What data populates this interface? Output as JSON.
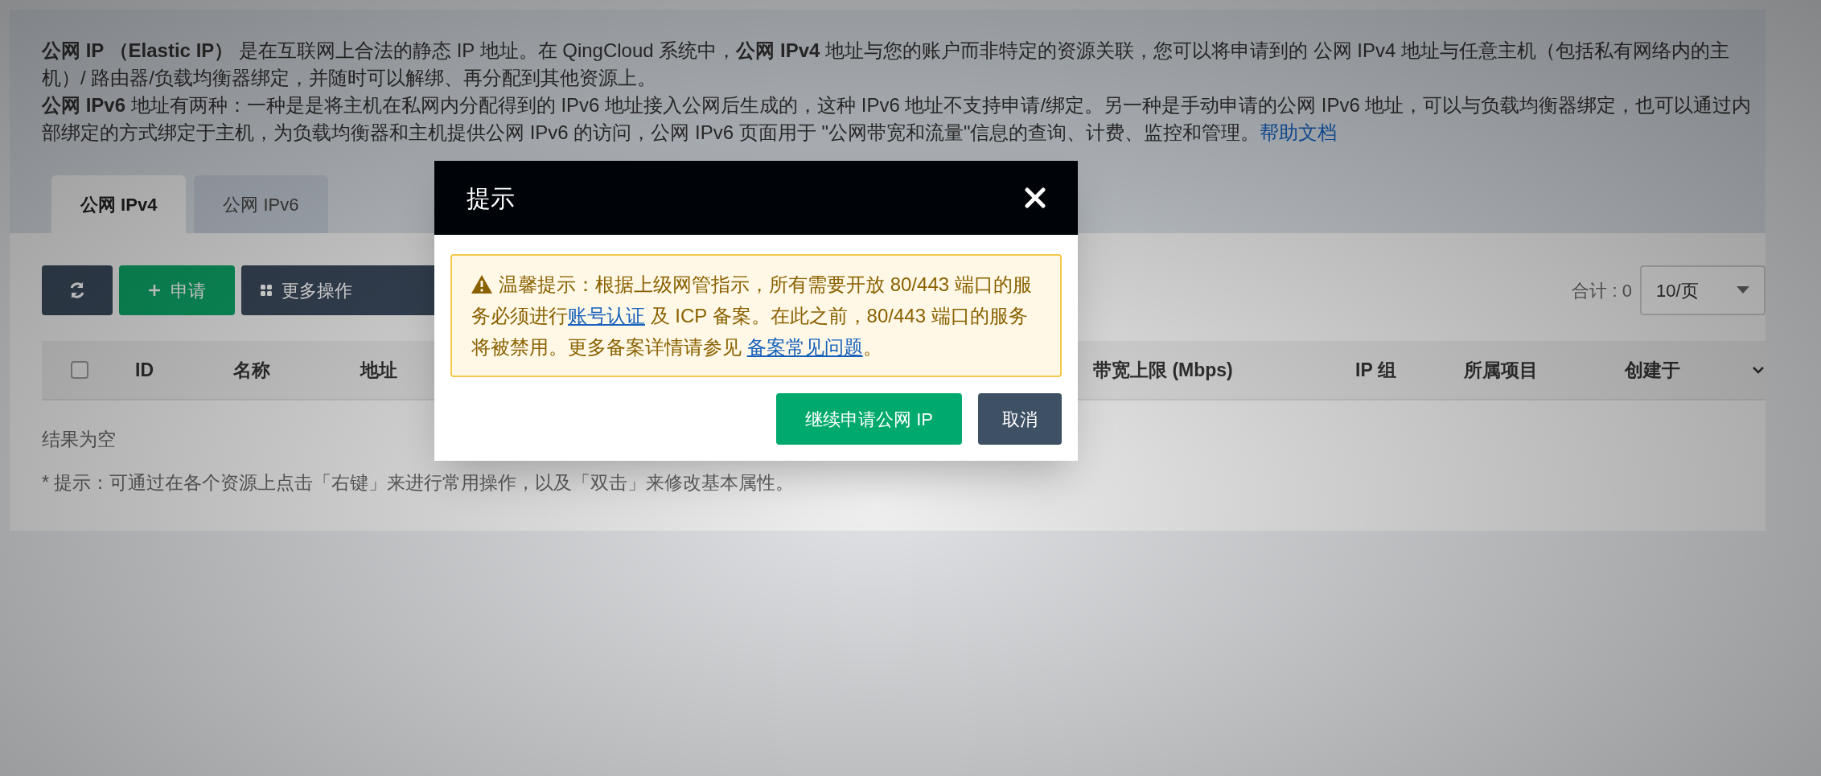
{
  "intro": [
    {
      "text": "**公网 IP （Elastic IP）** 是在互联网上合法的静态 IP 地址。在 QingCloud 系统中，**公网 IPv4** 地址与您的账户而非特定的资源关联，您可以将申请到的 公网 IPv4 地址与任意主机（包括私有网络内的主机）/ 路由器/负载均衡器绑定，并随时可以解绑、再分配到其他资源上。"
    },
    {
      "text": "**公网 IPv6** 地址有两种：一种是是将主机在私网内分配得到的 IPv6 地址接入公网后生成的，这种 IPv6 地址不支持申请/绑定。另一种是手动申请的公网 IPv6 地址，可以与负载均衡器绑定，也可以通过内部绑定的方式绑定于主机，为负载均衡器和主机提供公网 IPv6 的访问，公网 IPv6 页面用于 \"公网带宽和流量\"信息的查询、计费、监控和管理。",
      "link": "帮助文档"
    }
  ],
  "tabs": [
    {
      "label": "公网 IPv4",
      "selected": true
    },
    {
      "label": "公网 IPv6",
      "selected": false
    }
  ],
  "toolbar": [
    {
      "kind": "refresh"
    },
    {
      "kind": "primary",
      "label": "申请"
    },
    {
      "kind": "menu",
      "label": "更多操作"
    }
  ],
  "total": "合计 : 0",
  "page_size": "10/页",
  "table": {
    "select_all_checked": false,
    "columns": [
      "ID",
      "名称",
      "地址",
      "带宽上限 (Mbps)",
      "IP 组",
      "所属项目",
      "创建于"
    ]
  },
  "empty_text": "结果为空",
  "tip": "* 提示：可通过在各个资源上点击「右键」来进行常用操作，以及「双击」来修改基本属性。",
  "dialog": {
    "title": "提示",
    "warning": [
      {
        "kind": "text",
        "text": "温馨提示：根据上级网管指示，所有需要开放 80/443 端口的服务必须进行"
      },
      {
        "kind": "link",
        "text": "账号认证"
      },
      {
        "kind": "text",
        "text": " 及 ICP 备案。在此之前，80/443 端口的服务将被禁用。更多备案详情请参见 "
      },
      {
        "kind": "link",
        "text": "备案常见问题"
      },
      {
        "kind": "text",
        "text": "。"
      }
    ],
    "buttons": [
      {
        "kind": "primary",
        "label": "继续申请公网 IP"
      },
      {
        "kind": "secondary",
        "label": "取消"
      }
    ]
  }
}
